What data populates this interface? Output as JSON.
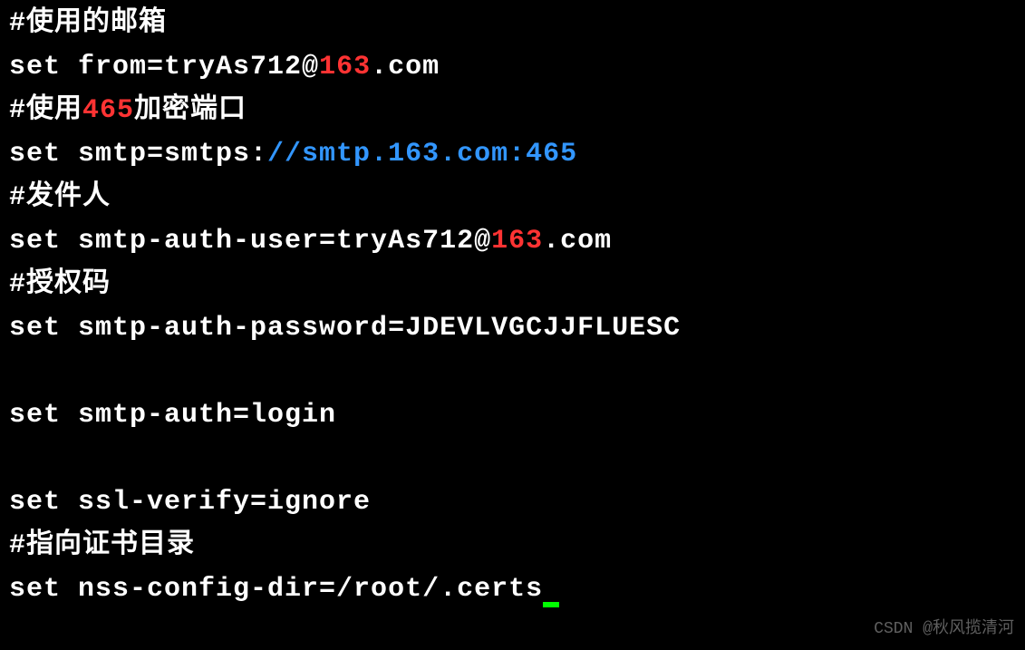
{
  "lines": [
    {
      "segments": [
        {
          "text": "#使用的邮箱",
          "class": "white"
        }
      ]
    },
    {
      "segments": [
        {
          "text": "set from=tryAs712@",
          "class": "white"
        },
        {
          "text": "163",
          "class": "red"
        },
        {
          "text": ".com",
          "class": "white"
        }
      ]
    },
    {
      "segments": [
        {
          "text": "#使用",
          "class": "white"
        },
        {
          "text": "465",
          "class": "red"
        },
        {
          "text": "加密端口",
          "class": "white"
        }
      ]
    },
    {
      "segments": [
        {
          "text": "set smtp=smtps:",
          "class": "white"
        },
        {
          "text": "//smtp.163.com:465",
          "class": "blue"
        }
      ]
    },
    {
      "segments": [
        {
          "text": "#发件人",
          "class": "white"
        }
      ]
    },
    {
      "segments": [
        {
          "text": "set smtp-auth-user=tryAs712@",
          "class": "white"
        },
        {
          "text": "163",
          "class": "red"
        },
        {
          "text": ".com",
          "class": "white"
        }
      ]
    },
    {
      "segments": [
        {
          "text": "#授权码",
          "class": "white"
        }
      ]
    },
    {
      "segments": [
        {
          "text": "set smtp-auth-password=JDEVLVGCJJFLUESC",
          "class": "white"
        }
      ]
    },
    {
      "segments": [
        {
          "text": " ",
          "class": "white"
        }
      ]
    },
    {
      "segments": [
        {
          "text": "set smtp-auth=login",
          "class": "white"
        }
      ]
    },
    {
      "segments": [
        {
          "text": " ",
          "class": "white"
        }
      ]
    },
    {
      "segments": [
        {
          "text": "set ssl-verify=ignore",
          "class": "white"
        }
      ]
    },
    {
      "segments": [
        {
          "text": "#指向证书目录",
          "class": "white"
        }
      ]
    },
    {
      "segments": [
        {
          "text": "set nss-config-dir=/root/.certs",
          "class": "white"
        }
      ],
      "cursor": true
    }
  ],
  "watermark": "CSDN @秋风揽清河"
}
